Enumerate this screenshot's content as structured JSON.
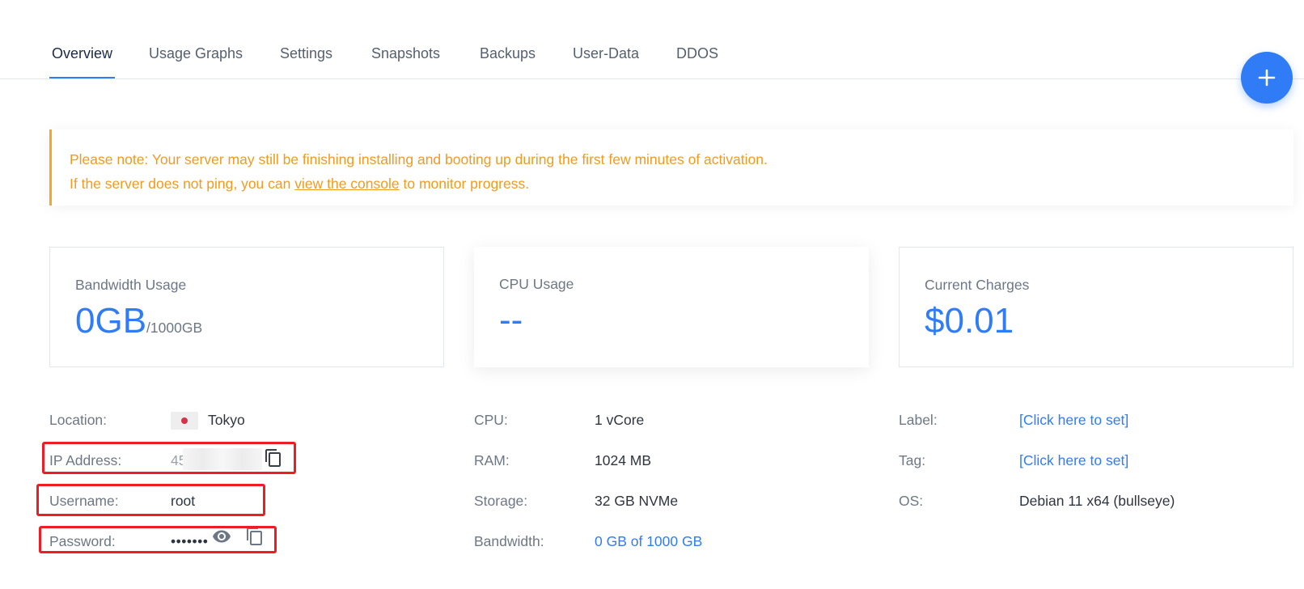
{
  "tabs": [
    {
      "label": "Overview",
      "active": true
    },
    {
      "label": "Usage Graphs"
    },
    {
      "label": "Settings"
    },
    {
      "label": "Snapshots"
    },
    {
      "label": "Backups"
    },
    {
      "label": "User-Data"
    },
    {
      "label": "DDOS"
    }
  ],
  "fab": {
    "icon": "plus-icon"
  },
  "notice": {
    "line1": "Please note: Your server may still be finishing installing and booting up during the first few minutes of activation.",
    "line2_before": "If the server does not ping, you can ",
    "line2_link": "view the console",
    "line2_after": " to monitor progress."
  },
  "cards": {
    "bandwidth": {
      "label": "Bandwidth Usage",
      "value": "0GB",
      "sub": "/1000GB"
    },
    "cpu": {
      "label": "CPU Usage",
      "value": "--"
    },
    "charges": {
      "label": "Current Charges",
      "value": "$0.01"
    }
  },
  "details": {
    "location": {
      "label": "Location:",
      "value": "Tokyo",
      "flag": "japan-flag"
    },
    "ip": {
      "label": "IP Address:",
      "value": "45"
    },
    "username": {
      "label": "Username:",
      "value": "root"
    },
    "password": {
      "label": "Password:",
      "value": "•••••••"
    },
    "cpu": {
      "label": "CPU:",
      "value": "1 vCore"
    },
    "ram": {
      "label": "RAM:",
      "value": "1024 MB"
    },
    "storage": {
      "label": "Storage:",
      "value": "32 GB NVMe"
    },
    "bandwidth": {
      "label": "Bandwidth:",
      "value": "0 GB of 1000 GB"
    },
    "label": {
      "label": "Label:",
      "value": "[Click here to set]"
    },
    "tag": {
      "label": "Tag:",
      "value": "[Click here to set]"
    },
    "os": {
      "label": "OS:",
      "value": "Debian 11 x64 (bullseye)"
    }
  },
  "colors": {
    "accent": "#2f7cf6",
    "warning": "#f29a1f",
    "highlight": "#ee1c25"
  }
}
